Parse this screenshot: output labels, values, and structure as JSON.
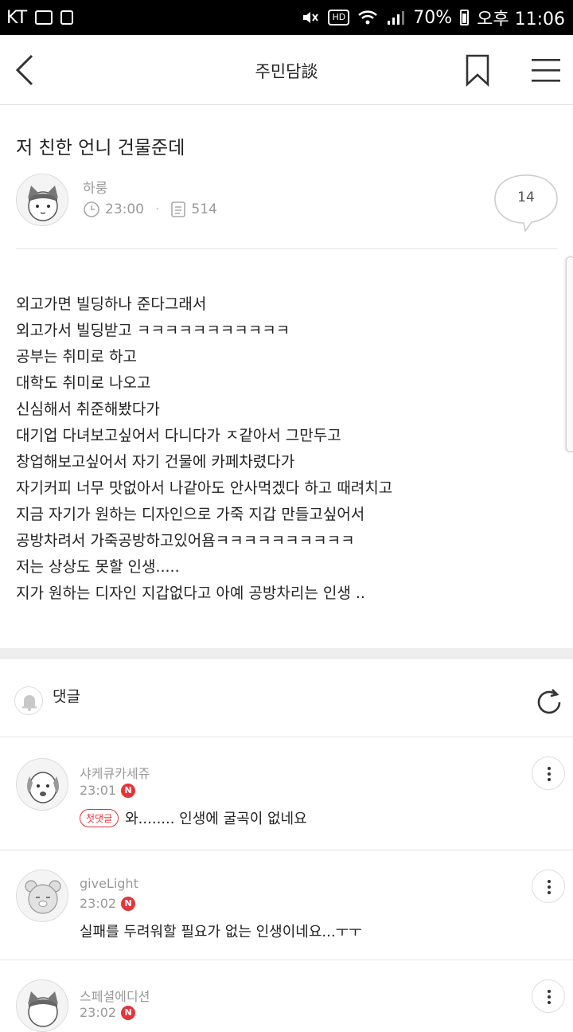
{
  "status_bar": {
    "carrier": "KT",
    "hd": "HD",
    "battery": "70%",
    "time": "오후 11:06"
  },
  "header": {
    "title": "주민담談"
  },
  "post": {
    "title": "저 친한 언니 건물준데",
    "author": "하룽",
    "time": "23:00",
    "views": "514",
    "comment_count": "14",
    "body": [
      "외고가면 빌딩하나 준다그래서",
      "외고가서 빌딩받고 ㅋㅋㅋㅋㅋㅋㅋㅋㅋㅋㅋ",
      "공부는 취미로 하고",
      "대학도 취미로 나오고",
      "신심해서 취준해봤다가",
      "대기업 다녀보고싶어서 다니다가 ㅈ같아서 그만두고",
      "창업해보고싶어서 자기 건물에 카페차렸다가",
      "자기커피 너무 맛없아서 나같아도 안사먹겠다 하고 때려치고",
      "지금 자기가 원하는 디자인으로 가죽 지갑 만들고싶어서",
      "공방차려서 가죽공방하고있어욤ㅋㅋㅋㅋㅋㅋㅋㅋㅋㅋ",
      "저는 상상도 못할 인생.....",
      "지가 원하는 디자인 지갑없다고 아예 공방차리는 인생 .."
    ]
  },
  "comments_section": {
    "label": "댓글",
    "new_badge": "N",
    "first_badge": "첫댓글",
    "items": [
      {
        "name": "샤케큐카세쥬",
        "time": "23:01",
        "text": "와........ 인생에 굴곡이 없네요"
      },
      {
        "name": "giveLight",
        "time": "23:02",
        "text": "실패를 두려워할 필요가 없는 인생이네요...ㅜㅜ"
      },
      {
        "name": "스페셜에디션",
        "time": "23:02",
        "text": ""
      }
    ]
  },
  "colors": {
    "accent_red": "#e4353a",
    "meta_gray": "#999999",
    "divider": "#e4e4e4"
  }
}
